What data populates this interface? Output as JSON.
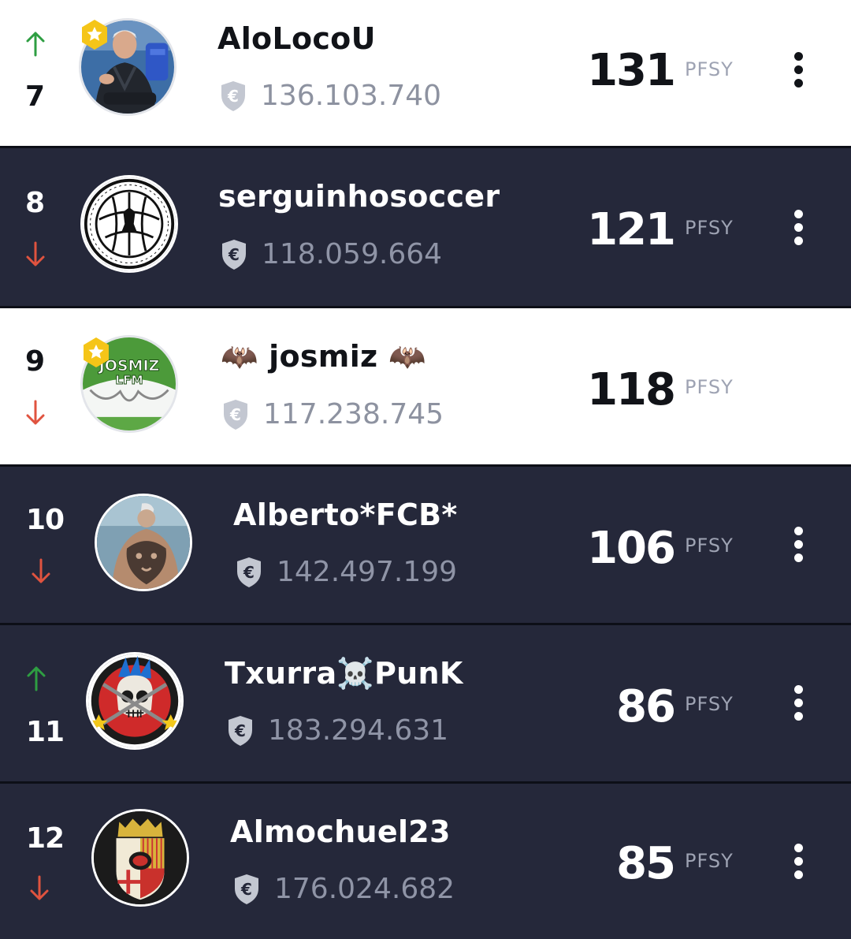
{
  "unit_label": "PFSY",
  "colors": {
    "up": "#2e9e42",
    "down": "#e0533f",
    "light_row": "#ffffff",
    "dark_row": "#25283a",
    "star_badge": "#f5c518"
  },
  "rows": [
    {
      "rank": "7",
      "trend": "up",
      "name": "AloLocoU",
      "budget": "136.103.740",
      "points": "131",
      "theme": "light",
      "featured": true,
      "avatar_icon": "coach-photo-icon"
    },
    {
      "rank": "8",
      "trend": "down",
      "name": "serguinhosoccer",
      "budget": "118.059.664",
      "points": "121",
      "theme": "dark",
      "featured": false,
      "avatar_icon": "espiritu-indomable-badge-icon"
    },
    {
      "rank": "9",
      "trend": "down",
      "name": "🦇 josmiz 🦇",
      "budget": "117.238.745",
      "points": "118",
      "theme": "light",
      "featured": true,
      "avatar_icon": "josmiz-lfm-logo-icon"
    },
    {
      "rank": "10",
      "trend": "down",
      "name": "Alberto*FCB*",
      "budget": "142.497.199",
      "points": "106",
      "theme": "dark",
      "featured": false,
      "avatar_icon": "tattoo-back-photo-icon"
    },
    {
      "rank": "11",
      "trend": "up",
      "name": "Txurra☠️PunK",
      "budget": "183.294.631",
      "points": "86",
      "theme": "dark",
      "featured": false,
      "avatar_icon": "punk-skull-icon"
    },
    {
      "rank": "12",
      "trend": "down",
      "name": "Almochuel23",
      "budget": "176.024.682",
      "points": "85",
      "theme": "dark",
      "featured": false,
      "avatar_icon": "coat-of-arms-icon"
    }
  ]
}
